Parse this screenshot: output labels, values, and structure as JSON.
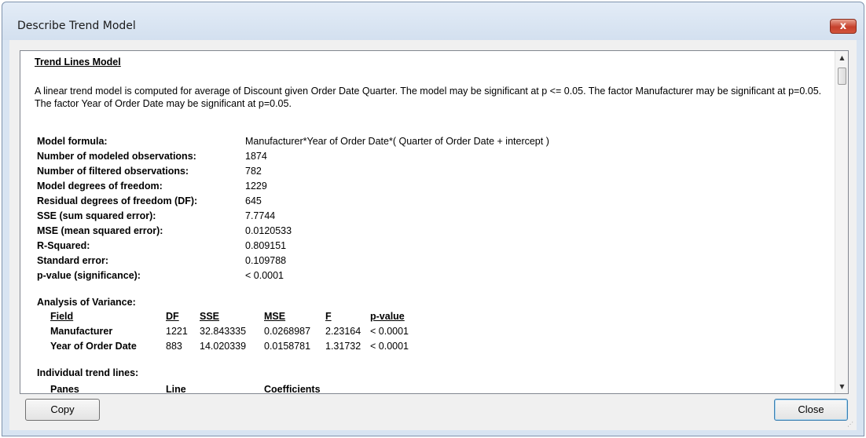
{
  "window": {
    "title": "Describe Trend Model",
    "close_glyph": "x"
  },
  "report": {
    "heading": "Trend Lines Model",
    "summary": "A linear trend model is computed for average of Discount given Order Date Quarter.  The model may be significant at p <= 0.05.  The factor Manufacturer may be significant at p=0.05.  The factor Year of Order Date may be significant at p=0.05.",
    "stats": [
      {
        "label": "Model formula:",
        "value": "Manufacturer*Year of Order Date*( Quarter of Order Date + intercept )"
      },
      {
        "label": "Number of modeled observations:",
        "value": "1874"
      },
      {
        "label": "Number of filtered observations:",
        "value": "782"
      },
      {
        "label": "Model degrees of freedom:",
        "value": "1229"
      },
      {
        "label": "Residual degrees of freedom (DF):",
        "value": "645"
      },
      {
        "label": "SSE (sum squared error):",
        "value": "7.7744"
      },
      {
        "label": "MSE (mean squared error):",
        "value": "0.0120533"
      },
      {
        "label": "R-Squared:",
        "value": "0.809151"
      },
      {
        "label": "Standard error:",
        "value": "0.109788"
      },
      {
        "label": "p-value (significance):",
        "value": "< 0.0001"
      }
    ],
    "anova": {
      "title": "Analysis of Variance:",
      "headers": [
        "Field",
        "DF",
        "SSE",
        "MSE",
        "F",
        "p-value"
      ],
      "rows": [
        [
          "Manufacturer",
          "1221",
          "32.843335",
          "0.0268987",
          "2.23164",
          "< 0.0001"
        ],
        [
          "Year of Order Date",
          "883",
          "14.020339",
          "0.0158781",
          "1.31732",
          "< 0.0001"
        ]
      ]
    },
    "trend_lines": {
      "title": "Individual trend lines:",
      "headers": [
        "Panes",
        "Line",
        "Coefficients"
      ]
    }
  },
  "buttons": {
    "copy": "Copy",
    "close": "Close"
  },
  "scrollbar": {
    "up_glyph": "▲",
    "down_glyph": "▼"
  }
}
